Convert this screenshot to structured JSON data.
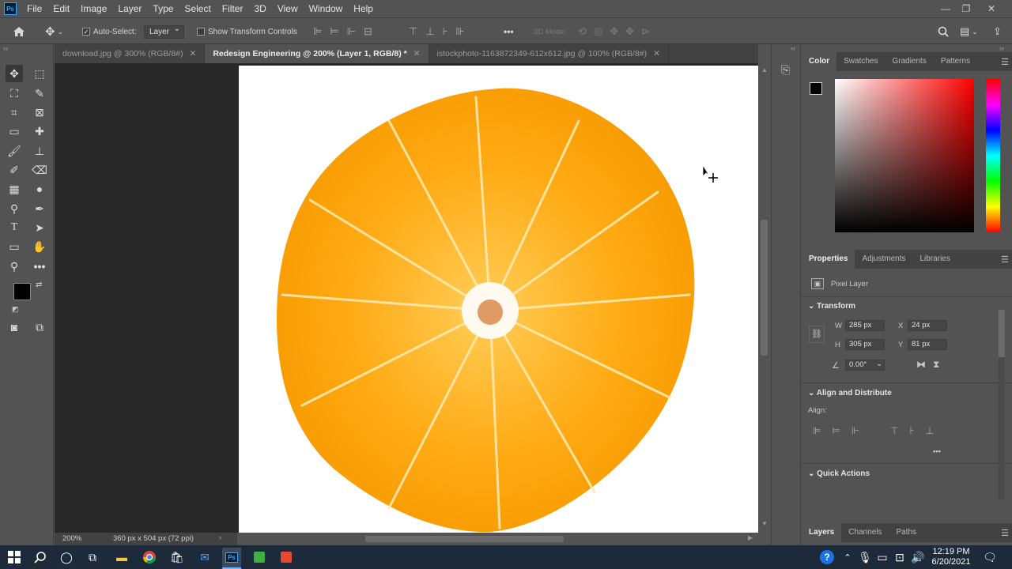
{
  "menu": [
    "File",
    "Edit",
    "Image",
    "Layer",
    "Type",
    "Select",
    "Filter",
    "3D",
    "View",
    "Window",
    "Help"
  ],
  "app_logo": "Ps",
  "options": {
    "auto_select_label": "Auto-Select:",
    "auto_select_checked": true,
    "auto_select_target": "Layer",
    "show_transform_label": "Show Transform Controls",
    "more_label": "•••",
    "mode_3d_label": "3D Mode:"
  },
  "tabs": [
    {
      "label": "download.jpg @ 300% (RGB/8#)",
      "active": false
    },
    {
      "label": "Redesign Engineering @ 200% (Layer 1, RGB/8) *",
      "active": true
    },
    {
      "label": "istockphoto-1163872349-612x612.jpg @ 100% (RGB/8#)",
      "active": false
    }
  ],
  "status": {
    "zoom": "200%",
    "doc_info": "360 px x 504 px (72 ppi)"
  },
  "color_panel": {
    "tabs": [
      "Color",
      "Swatches",
      "Gradients",
      "Patterns"
    ],
    "active": "Color",
    "foreground": "#000000",
    "background": "#ffffff",
    "hue": "#ff0000"
  },
  "properties_panel": {
    "tabs": [
      "Properties",
      "Adjustments",
      "Libraries"
    ],
    "active": "Properties",
    "layer_type": "Pixel Layer",
    "transform_title": "Transform",
    "w_label": "W",
    "w_value": "285 px",
    "h_label": "H",
    "h_value": "305 px",
    "x_label": "X",
    "x_value": "24 px",
    "y_label": "Y",
    "y_value": "81 px",
    "angle_value": "0.00°",
    "align_title": "Align and Distribute",
    "align_label": "Align:",
    "more": "•••",
    "quick_actions_title": "Quick Actions"
  },
  "layers_panel": {
    "tabs": [
      "Layers",
      "Channels",
      "Paths"
    ],
    "active": "Layers"
  },
  "taskbar": {
    "time": "12:19 PM",
    "date": "6/20/2021"
  },
  "colors": {
    "ui_bg": "#535353",
    "canvas_bg": "#282828",
    "tab_bg": "#424242",
    "orange": "#ffa514",
    "taskbar": "#1c2a3a"
  }
}
